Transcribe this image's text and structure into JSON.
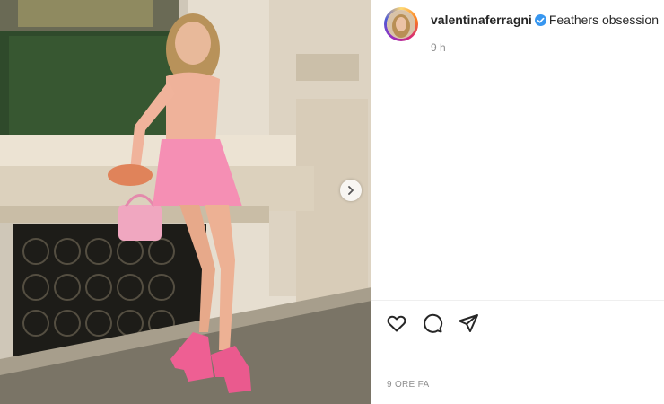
{
  "post": {
    "username": "valentinaferragni",
    "caption": "Feathers obsession",
    "relative_time": "9 h",
    "footer_time": "9 ORE FA",
    "verified": true
  },
  "icons": {
    "verified": "verified-badge-icon",
    "like": "heart-icon",
    "comment": "comment-bubble-icon",
    "share": "paper-plane-icon",
    "next": "chevron-right-icon"
  },
  "colors": {
    "verified_blue": "#3897f0",
    "text": "#262626",
    "muted": "#8e8e8e"
  }
}
